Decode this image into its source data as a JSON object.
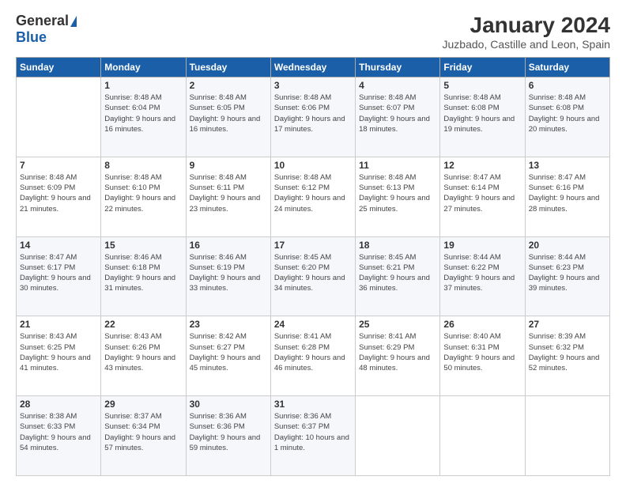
{
  "header": {
    "logo_general": "General",
    "logo_blue": "Blue",
    "title": "January 2024",
    "subtitle": "Juzbado, Castille and Leon, Spain"
  },
  "calendar": {
    "weekdays": [
      "Sunday",
      "Monday",
      "Tuesday",
      "Wednesday",
      "Thursday",
      "Friday",
      "Saturday"
    ],
    "weeks": [
      [
        {
          "day": "",
          "sunrise": "",
          "sunset": "",
          "daylight": ""
        },
        {
          "day": "1",
          "sunrise": "Sunrise: 8:48 AM",
          "sunset": "Sunset: 6:04 PM",
          "daylight": "Daylight: 9 hours and 16 minutes."
        },
        {
          "day": "2",
          "sunrise": "Sunrise: 8:48 AM",
          "sunset": "Sunset: 6:05 PM",
          "daylight": "Daylight: 9 hours and 16 minutes."
        },
        {
          "day": "3",
          "sunrise": "Sunrise: 8:48 AM",
          "sunset": "Sunset: 6:06 PM",
          "daylight": "Daylight: 9 hours and 17 minutes."
        },
        {
          "day": "4",
          "sunrise": "Sunrise: 8:48 AM",
          "sunset": "Sunset: 6:07 PM",
          "daylight": "Daylight: 9 hours and 18 minutes."
        },
        {
          "day": "5",
          "sunrise": "Sunrise: 8:48 AM",
          "sunset": "Sunset: 6:08 PM",
          "daylight": "Daylight: 9 hours and 19 minutes."
        },
        {
          "day": "6",
          "sunrise": "Sunrise: 8:48 AM",
          "sunset": "Sunset: 6:08 PM",
          "daylight": "Daylight: 9 hours and 20 minutes."
        }
      ],
      [
        {
          "day": "7",
          "sunrise": "Sunrise: 8:48 AM",
          "sunset": "Sunset: 6:09 PM",
          "daylight": "Daylight: 9 hours and 21 minutes."
        },
        {
          "day": "8",
          "sunrise": "Sunrise: 8:48 AM",
          "sunset": "Sunset: 6:10 PM",
          "daylight": "Daylight: 9 hours and 22 minutes."
        },
        {
          "day": "9",
          "sunrise": "Sunrise: 8:48 AM",
          "sunset": "Sunset: 6:11 PM",
          "daylight": "Daylight: 9 hours and 23 minutes."
        },
        {
          "day": "10",
          "sunrise": "Sunrise: 8:48 AM",
          "sunset": "Sunset: 6:12 PM",
          "daylight": "Daylight: 9 hours and 24 minutes."
        },
        {
          "day": "11",
          "sunrise": "Sunrise: 8:48 AM",
          "sunset": "Sunset: 6:13 PM",
          "daylight": "Daylight: 9 hours and 25 minutes."
        },
        {
          "day": "12",
          "sunrise": "Sunrise: 8:47 AM",
          "sunset": "Sunset: 6:14 PM",
          "daylight": "Daylight: 9 hours and 27 minutes."
        },
        {
          "day": "13",
          "sunrise": "Sunrise: 8:47 AM",
          "sunset": "Sunset: 6:16 PM",
          "daylight": "Daylight: 9 hours and 28 minutes."
        }
      ],
      [
        {
          "day": "14",
          "sunrise": "Sunrise: 8:47 AM",
          "sunset": "Sunset: 6:17 PM",
          "daylight": "Daylight: 9 hours and 30 minutes."
        },
        {
          "day": "15",
          "sunrise": "Sunrise: 8:46 AM",
          "sunset": "Sunset: 6:18 PM",
          "daylight": "Daylight: 9 hours and 31 minutes."
        },
        {
          "day": "16",
          "sunrise": "Sunrise: 8:46 AM",
          "sunset": "Sunset: 6:19 PM",
          "daylight": "Daylight: 9 hours and 33 minutes."
        },
        {
          "day": "17",
          "sunrise": "Sunrise: 8:45 AM",
          "sunset": "Sunset: 6:20 PM",
          "daylight": "Daylight: 9 hours and 34 minutes."
        },
        {
          "day": "18",
          "sunrise": "Sunrise: 8:45 AM",
          "sunset": "Sunset: 6:21 PM",
          "daylight": "Daylight: 9 hours and 36 minutes."
        },
        {
          "day": "19",
          "sunrise": "Sunrise: 8:44 AM",
          "sunset": "Sunset: 6:22 PM",
          "daylight": "Daylight: 9 hours and 37 minutes."
        },
        {
          "day": "20",
          "sunrise": "Sunrise: 8:44 AM",
          "sunset": "Sunset: 6:23 PM",
          "daylight": "Daylight: 9 hours and 39 minutes."
        }
      ],
      [
        {
          "day": "21",
          "sunrise": "Sunrise: 8:43 AM",
          "sunset": "Sunset: 6:25 PM",
          "daylight": "Daylight: 9 hours and 41 minutes."
        },
        {
          "day": "22",
          "sunrise": "Sunrise: 8:43 AM",
          "sunset": "Sunset: 6:26 PM",
          "daylight": "Daylight: 9 hours and 43 minutes."
        },
        {
          "day": "23",
          "sunrise": "Sunrise: 8:42 AM",
          "sunset": "Sunset: 6:27 PM",
          "daylight": "Daylight: 9 hours and 45 minutes."
        },
        {
          "day": "24",
          "sunrise": "Sunrise: 8:41 AM",
          "sunset": "Sunset: 6:28 PM",
          "daylight": "Daylight: 9 hours and 46 minutes."
        },
        {
          "day": "25",
          "sunrise": "Sunrise: 8:41 AM",
          "sunset": "Sunset: 6:29 PM",
          "daylight": "Daylight: 9 hours and 48 minutes."
        },
        {
          "day": "26",
          "sunrise": "Sunrise: 8:40 AM",
          "sunset": "Sunset: 6:31 PM",
          "daylight": "Daylight: 9 hours and 50 minutes."
        },
        {
          "day": "27",
          "sunrise": "Sunrise: 8:39 AM",
          "sunset": "Sunset: 6:32 PM",
          "daylight": "Daylight: 9 hours and 52 minutes."
        }
      ],
      [
        {
          "day": "28",
          "sunrise": "Sunrise: 8:38 AM",
          "sunset": "Sunset: 6:33 PM",
          "daylight": "Daylight: 9 hours and 54 minutes."
        },
        {
          "day": "29",
          "sunrise": "Sunrise: 8:37 AM",
          "sunset": "Sunset: 6:34 PM",
          "daylight": "Daylight: 9 hours and 57 minutes."
        },
        {
          "day": "30",
          "sunrise": "Sunrise: 8:36 AM",
          "sunset": "Sunset: 6:36 PM",
          "daylight": "Daylight: 9 hours and 59 minutes."
        },
        {
          "day": "31",
          "sunrise": "Sunrise: 8:36 AM",
          "sunset": "Sunset: 6:37 PM",
          "daylight": "Daylight: 10 hours and 1 minute."
        },
        {
          "day": "",
          "sunrise": "",
          "sunset": "",
          "daylight": ""
        },
        {
          "day": "",
          "sunrise": "",
          "sunset": "",
          "daylight": ""
        },
        {
          "day": "",
          "sunrise": "",
          "sunset": "",
          "daylight": ""
        }
      ]
    ]
  }
}
